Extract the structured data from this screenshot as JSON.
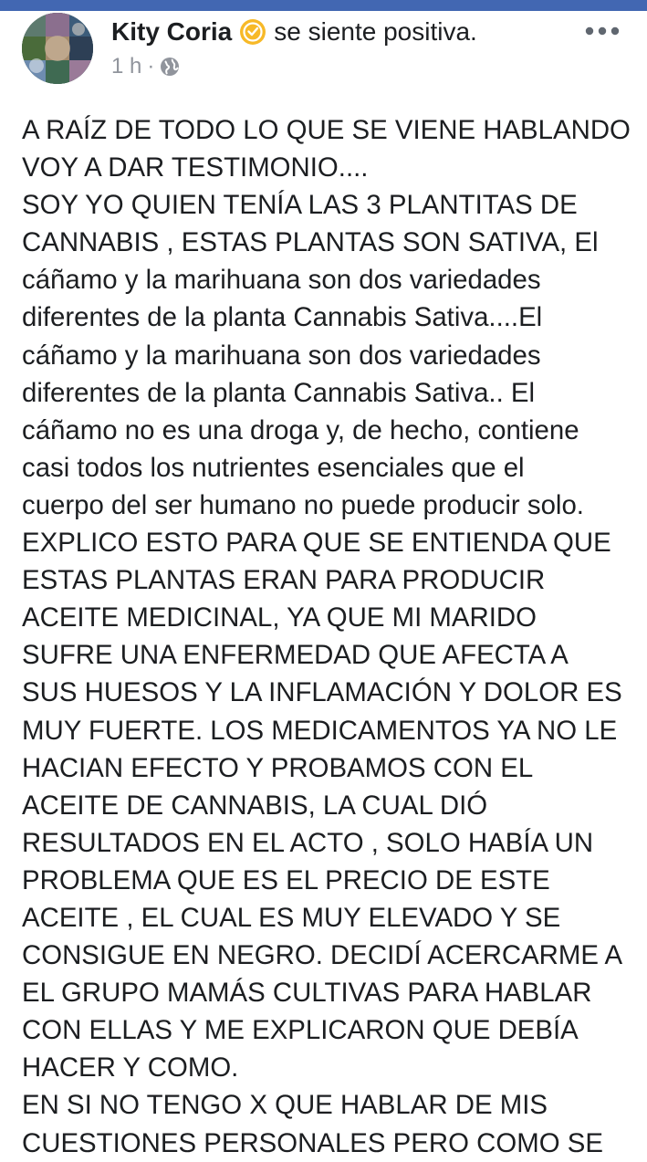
{
  "post": {
    "author": "Kity Coria",
    "feeling": "se siente positiva.",
    "time": "1 h",
    "separator": "·",
    "privacy_icon": "globe-icon",
    "feeling_icon": "smiley-icon",
    "menu_icon": "more-icon",
    "body_lines": [
      "A RAÍZ DE TODO LO QUE SE VIENE HABLANDO",
      "VOY A DAR TESTIMONIO....",
      "SOY YO QUIEN TENÍA LAS 3 PLANTITAS DE",
      "CANNABIS , ESTAS PLANTAS SON SATIVA,  El",
      "cáñamo y la marihuana son dos variedades",
      "diferentes de la planta Cannabis Sativa....El",
      "cáñamo y la marihuana son dos variedades",
      "diferentes de la planta Cannabis Sativa.. El",
      "cáñamo no es una droga y, de hecho, contiene",
      "casi todos los nutrientes esenciales que el",
      "cuerpo del ser humano no puede producir solo.",
      "EXPLICO ESTO PARA QUE SE ENTIENDA QUE",
      "ESTAS PLANTAS ERAN PARA PRODUCIR",
      "ACEITE MEDICINAL, YA QUE MI MARIDO",
      "SUFRE UNA ENFERMEDAD QUE AFECTA A",
      "SUS HUESOS Y LA INFLAMACIÓN Y DOLOR ES",
      "MUY FUERTE. LOS MEDICAMENTOS YA NO LE",
      "HACIAN EFECTO Y PROBAMOS CON EL",
      "ACEITE DE CANNABIS, LA CUAL DIÓ",
      "RESULTADOS EN EL ACTO , SOLO HABÍA UN",
      "PROBLEMA QUE ES EL PRECIO DE ESTE",
      "ACEITE , EL CUAL ES MUY ELEVADO Y SE",
      "CONSIGUE EN NEGRO. DECIDÍ ACERCARME A",
      "EL GRUPO MAMÁS CULTIVAS PARA HABLAR",
      "CON ELLAS Y ME EXPLICARON QUE DEBÍA",
      "HACER Y COMO.",
      "EN SI NO TENGO X QUE HABLAR DE MIS",
      "CUESTIONES PERSONALES PERO COMO SE"
    ]
  },
  "colors": {
    "top_strip": "#4267b2",
    "text": "#1c1e21",
    "meta": "#90949c",
    "feeling_icon": "#f7b928"
  }
}
